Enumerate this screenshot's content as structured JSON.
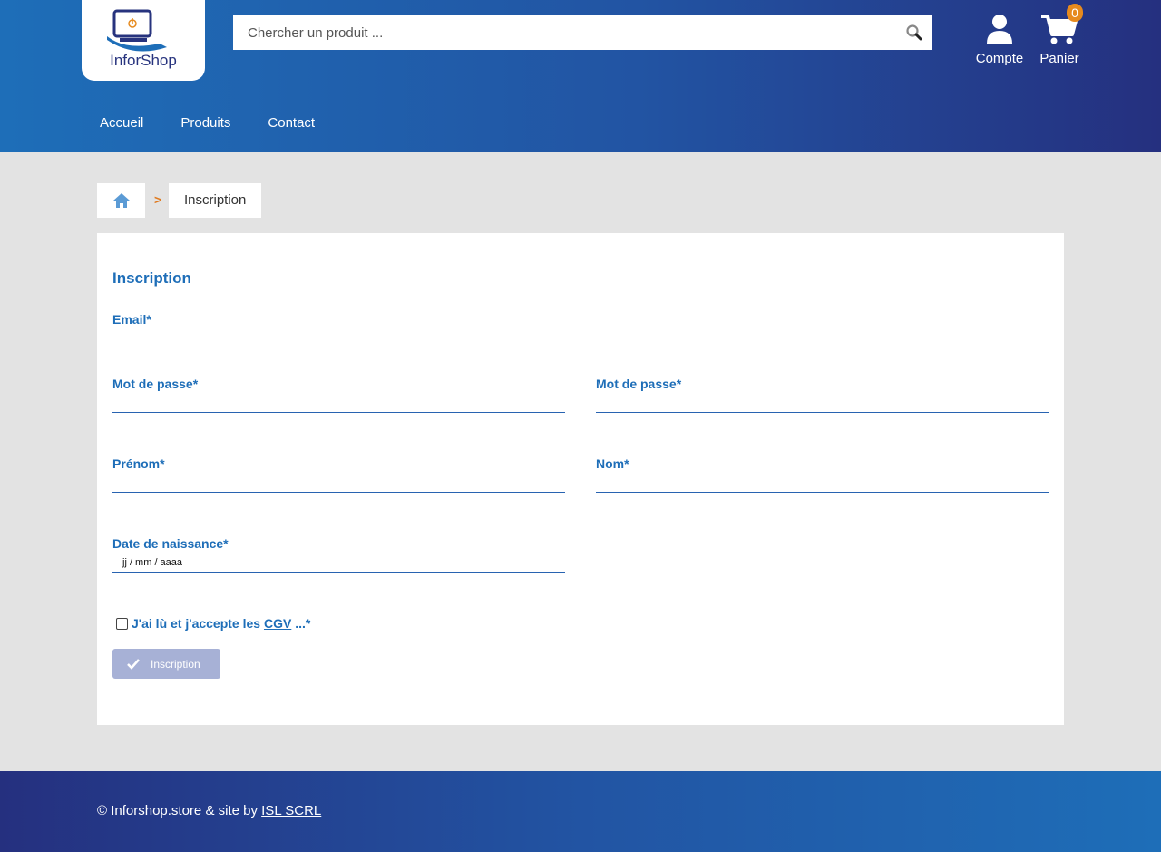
{
  "header": {
    "logo_text": "InforShop",
    "search": {
      "placeholder": "Chercher un produit ..."
    },
    "account_label": "Compte",
    "cart_label": "Panier",
    "cart_count": "0"
  },
  "nav": {
    "items": [
      {
        "label": "Accueil"
      },
      {
        "label": "Produits"
      },
      {
        "label": "Contact"
      }
    ]
  },
  "breadcrumb": {
    "separator": ">",
    "current": "Inscription"
  },
  "form": {
    "title": "Inscription",
    "email_label": "Email*",
    "password_label": "Mot de passe*",
    "password_confirm_label": "Mot de passe*",
    "firstname_label": "Prénom*",
    "lastname_label": "Nom*",
    "birthdate_label": "Date de naissance*",
    "birthdate_placeholder": "jj / mm / aaaa",
    "cgv_text_before": "J'ai lù et j'accepte les ",
    "cgv_link": "CGV",
    "cgv_text_after": " ...*",
    "submit_label": "Inscription"
  },
  "footer": {
    "text": "© Inforshop.store & site by ",
    "link": "ISL SCRL"
  },
  "colors": {
    "brand_blue": "#1e6eb8",
    "brand_dark": "#25307f",
    "accent_orange": "#e68a1e",
    "submit_disabled": "#a7b1d6"
  }
}
